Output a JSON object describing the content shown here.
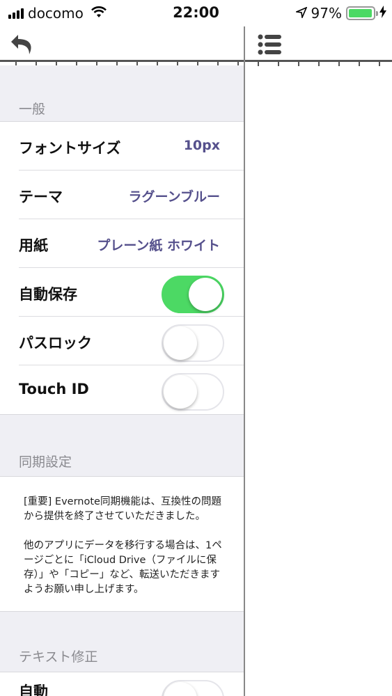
{
  "status_bar": {
    "carrier": "docomo",
    "time": "22:00",
    "battery_percent": "97%",
    "battery_level": 0.97,
    "battery_color": "#4cd964"
  },
  "toolbar": {
    "back_icon": "undo-arrow-icon",
    "list_icon": "list-icon"
  },
  "settings": {
    "general": {
      "header": "一般",
      "rows": [
        {
          "label": "フォントサイズ",
          "value": "10px"
        },
        {
          "label": "テーマ",
          "value": "ラグーンブルー"
        },
        {
          "label": "用紙",
          "value": "プレーン紙 ホワイト"
        }
      ],
      "toggles": [
        {
          "label": "自動保存",
          "on": true
        },
        {
          "label": "パスロック",
          "on": false
        },
        {
          "label": "Touch ID",
          "on": false
        }
      ]
    },
    "sync": {
      "header": "同期設定",
      "notice_p1": "[重要] Evernote同期機能は、互換性の問題から提供を終了させていただきました。",
      "notice_p2": "他のアプリにデータを移行する場合は、1ページごとに「iCloud Drive（ファイルに保存）」や「コピー」など、転送いただきますようお願い申し上げます。"
    },
    "text_correction": {
      "header": "テキスト修正",
      "rows": [
        {
          "label": "自動",
          "on": false
        }
      ]
    }
  },
  "colors": {
    "accent_value": "#55508c",
    "toggle_on": "#4cd964"
  }
}
